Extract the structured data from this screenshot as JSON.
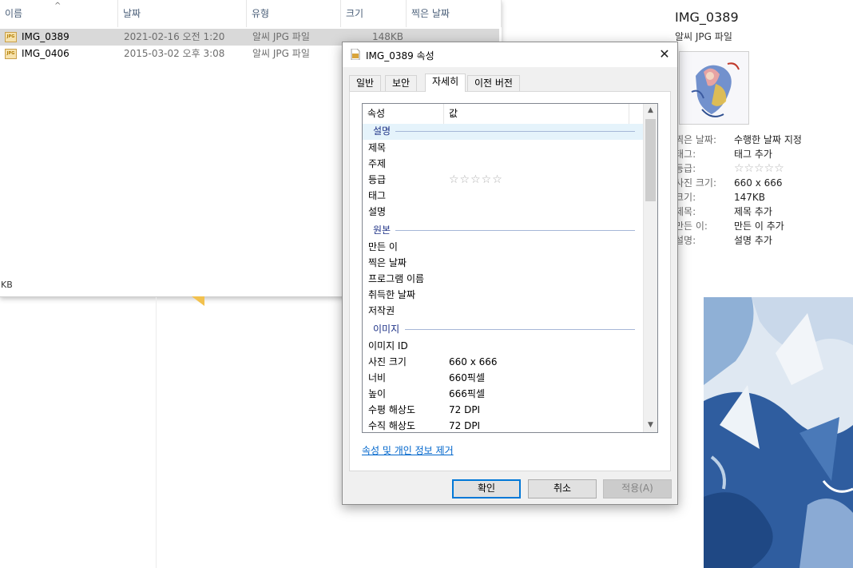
{
  "explorer": {
    "columns": [
      "이름",
      "날짜",
      "유형",
      "크기",
      "찍은 날짜"
    ],
    "files": [
      {
        "name": "IMG_0389",
        "date": "2021-02-16 오전 1:20",
        "type": "알씨 JPG 파일",
        "size": "148KB",
        "selected": true
      },
      {
        "name": "IMG_0406",
        "date": "2015-03-02 오후 3:08",
        "type": "알씨 JPG 파일",
        "size": ""
      }
    ],
    "status_fragment": "KB",
    "file_icon_text": "JPG"
  },
  "details": {
    "name": "IMG_0389",
    "type": "알씨 JPG 파일",
    "rows": [
      {
        "k": "찍은 날짜:",
        "v": "수행한 날짜 지정"
      },
      {
        "k": "태그:",
        "v": "태그 추가"
      },
      {
        "k": "등급:",
        "v": "☆☆☆☆☆",
        "rating": 0
      },
      {
        "k": "사진 크기:",
        "v": "660 x 666"
      },
      {
        "k": "크기:",
        "v": "147KB"
      },
      {
        "k": "제목:",
        "v": "제목 추가"
      },
      {
        "k": "만든 이:",
        "v": "만든 이 추가"
      },
      {
        "k": "설명:",
        "v": "설명 추가"
      }
    ]
  },
  "dialog": {
    "title": "IMG_0389 속성",
    "close_glyph": "✕",
    "tabs": [
      "일반",
      "보안",
      "자세히",
      "이전 버전"
    ],
    "active_tab": 2,
    "list_header": {
      "property": "속성",
      "value": "값"
    },
    "groups": [
      {
        "name": "설명",
        "items": [
          {
            "k": "제목",
            "v": ""
          },
          {
            "k": "주제",
            "v": ""
          },
          {
            "k": "등급",
            "v": "☆☆☆☆☆",
            "rating": 0
          },
          {
            "k": "태그",
            "v": ""
          },
          {
            "k": "설명",
            "v": ""
          }
        ]
      },
      {
        "name": "원본",
        "items": [
          {
            "k": "만든 이",
            "v": ""
          },
          {
            "k": "찍은 날짜",
            "v": ""
          },
          {
            "k": "프로그램 이름",
            "v": ""
          },
          {
            "k": "취득한 날짜",
            "v": ""
          },
          {
            "k": "저작권",
            "v": ""
          }
        ]
      },
      {
        "name": "이미지",
        "items": [
          {
            "k": "이미지 ID",
            "v": ""
          },
          {
            "k": "사진 크기",
            "v": "660 x 666"
          },
          {
            "k": "너비",
            "v": "660픽셀"
          },
          {
            "k": "높이",
            "v": "666픽셀"
          },
          {
            "k": "수평 해상도",
            "v": "72 DPI"
          },
          {
            "k": "수직 해상도",
            "v": "72 DPI"
          }
        ]
      }
    ],
    "remove_link": "속성 및 개인 정보 제거",
    "buttons": {
      "ok": "확인",
      "cancel": "취소",
      "apply": "적용(A)"
    }
  },
  "colors": {
    "accent": "#0078d7",
    "link": "#0066cc",
    "group_text": "#1e3287",
    "selection": "#d9d9d9"
  }
}
